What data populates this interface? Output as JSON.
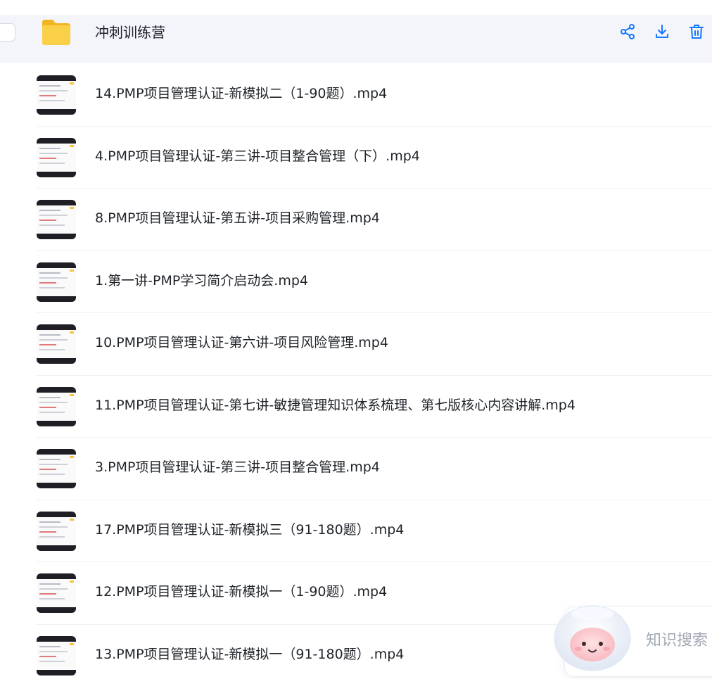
{
  "folder": {
    "name": "冲刺训练营",
    "actions": [
      {
        "name": "share",
        "icon": "share-icon"
      },
      {
        "name": "download",
        "icon": "download-icon"
      },
      {
        "name": "delete",
        "icon": "trash-icon"
      }
    ]
  },
  "files": [
    {
      "name": "14.PMP项目管理认证-新模拟二（1-90题）.mp4"
    },
    {
      "name": "4.PMP项目管理认证-第三讲-项目整合管理（下）.mp4"
    },
    {
      "name": "8.PMP项目管理认证-第五讲-项目采购管理.mp4"
    },
    {
      "name": "1.第一讲-PMP学习简介启动会.mp4"
    },
    {
      "name": "10.PMP项目管理认证-第六讲-项目风险管理.mp4"
    },
    {
      "name": "11.PMP项目管理认证-第七讲-敏捷管理知识体系梳理、第七版核心内容讲解.mp4"
    },
    {
      "name": "3.PMP项目管理认证-第三讲-项目整合管理.mp4"
    },
    {
      "name": "17.PMP项目管理认证-新模拟三（91-180题）.mp4"
    },
    {
      "name": "12.PMP项目管理认证-新模拟一（1-90题）.mp4"
    },
    {
      "name": "13.PMP项目管理认证-新模拟一（91-180题）.mp4"
    }
  ],
  "assistant": {
    "label": "知识搜索"
  },
  "colors": {
    "accent": "#1677ff",
    "folder": "#f7c531",
    "row_highlight": "#f3f5fa"
  }
}
